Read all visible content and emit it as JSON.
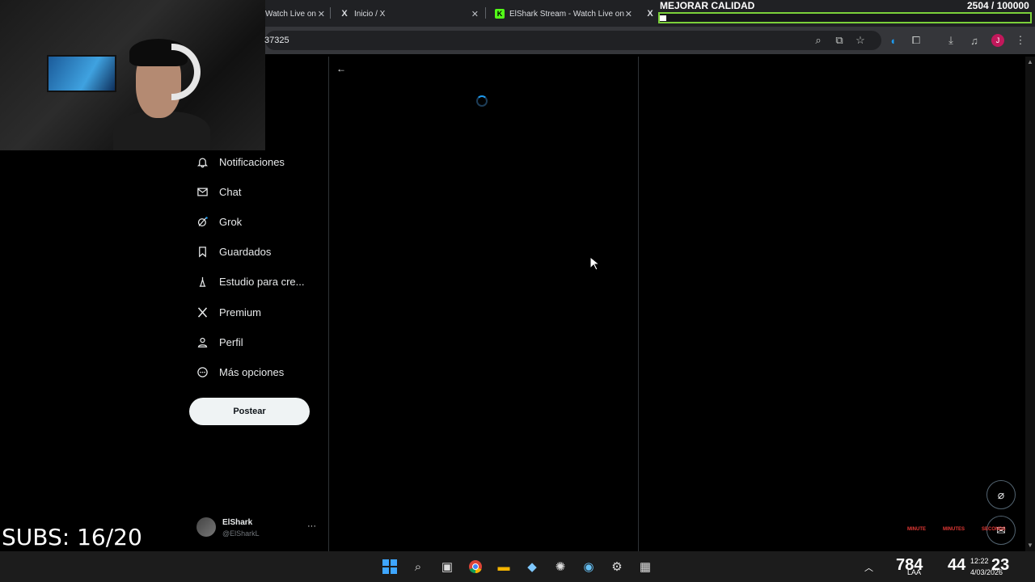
{
  "browser": {
    "tabs": [
      {
        "label": "Watch Live on",
        "favicon": "k-icon"
      },
      {
        "label": "Inicio / X",
        "favicon": "x-icon"
      },
      {
        "label": "ElShark Stream - Watch Live on",
        "favicon": "kick-icon"
      },
      {
        "label": "",
        "favicon": "x-icon"
      }
    ],
    "url": "37325",
    "accent": "#1d9bf0"
  },
  "overlay": {
    "title": "MEJORAR CALIDAD",
    "progress_text": "2504  / 100000",
    "progress": 0.025
  },
  "sidebar": {
    "items": [
      {
        "label": "Notificaciones",
        "icon": "bell-icon"
      },
      {
        "label": "Chat",
        "icon": "mail-icon"
      },
      {
        "label": "Grok",
        "icon": "grok-icon"
      },
      {
        "label": "Guardados",
        "icon": "bookmark-icon"
      },
      {
        "label": "Estudio para cre...",
        "icon": "studio-icon"
      },
      {
        "label": "Premium",
        "icon": "x-icon"
      },
      {
        "label": "Perfil",
        "icon": "person-icon"
      },
      {
        "label": "Más opciones",
        "icon": "more-circle-icon"
      }
    ],
    "post_label": "Postear",
    "user": {
      "name": "ElShark",
      "handle": "@ElSharkL",
      "more": "···"
    }
  },
  "stream": {
    "subs": "SUBS: 16/20",
    "counter": {
      "hours_label": "MINUTE",
      "minutes_label": "MINUTES",
      "seconds_label": "SECONDS"
    }
  },
  "taskbar": {
    "tray": {
      "value": "784",
      "lang": "LAA",
      "time": "12:22",
      "date": "4/03/2026",
      "c1": "44",
      "c2": "23"
    }
  }
}
